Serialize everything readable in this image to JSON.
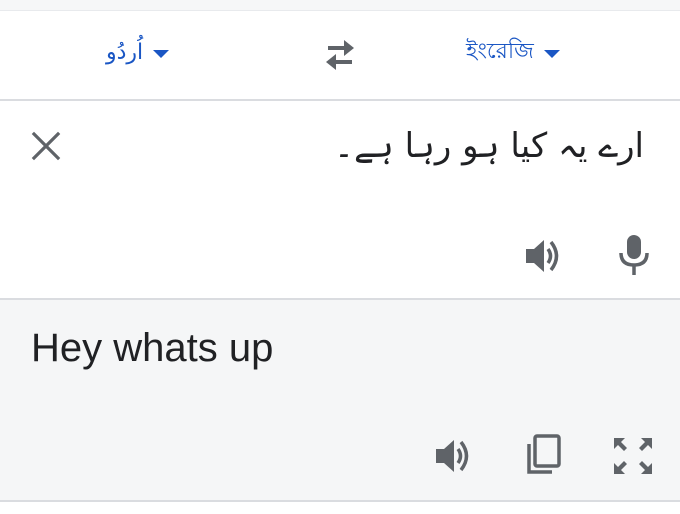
{
  "language_bar": {
    "source_language": "اُردُو",
    "target_language": "ইংরেজি"
  },
  "input": {
    "source_text": "ارے یہ کیا ہو رہا ہے۔"
  },
  "output": {
    "translated_text": "Hey whats up"
  },
  "icons": {
    "source_dropdown": "caret-down-icon",
    "target_dropdown": "caret-down-icon",
    "swap": "swap-arrows-icon",
    "clear": "close-icon",
    "source_listen": "speaker-icon",
    "voice_input": "mic-icon",
    "translation_listen": "speaker-icon",
    "copy": "copy-icon",
    "fullscreen": "fullscreen-icon"
  },
  "colors": {
    "accent": "#1a56c4",
    "icon": "#5f6368",
    "text": "#202124",
    "output_background": "#f5f6f7",
    "divider": "#dadce0"
  }
}
